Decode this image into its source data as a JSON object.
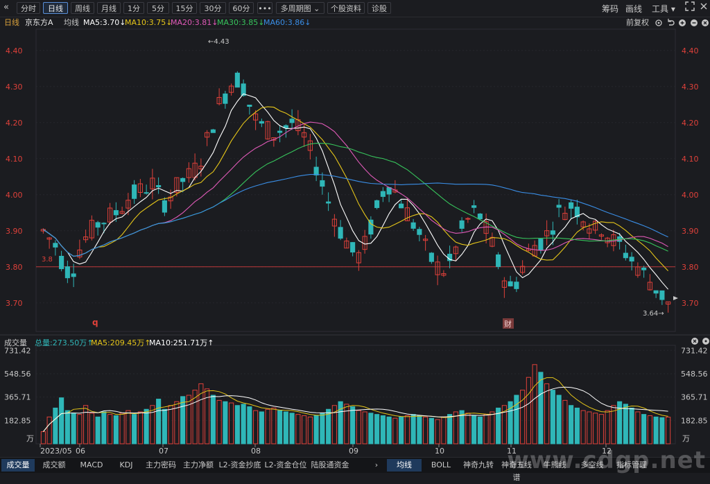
{
  "toolbar": {
    "collapse_icon": "«",
    "buttons": [
      "分时",
      "日线",
      "周线",
      "月线",
      "1分",
      "5分",
      "15分",
      "30分",
      "60分",
      "•••",
      "多周期图 ⌄",
      "个股资料",
      "诊股"
    ],
    "active": "日线",
    "right": [
      "筹码",
      "画线",
      "工具 ▾"
    ],
    "expand_icon": "expand-icon",
    "close_icon": "close-icon"
  },
  "info_bar": {
    "period": "日线",
    "stock_name": "京东方A",
    "line_type": "均线",
    "ma5": "MA5:3.70↓",
    "ma10": "MA10:3.75↓",
    "ma20": "MA20:3.81↓",
    "ma30": "MA30:3.85↓",
    "ma60": "MA60:3.86↓",
    "adjust": "前复权",
    "colors": {
      "ma5": "#ffffff",
      "ma10": "#e6c619",
      "ma20": "#e05ab8",
      "ma30": "#37c45c",
      "ma60": "#3a8ee6"
    }
  },
  "volume_bar": {
    "title": "成交量",
    "total": "总量:273.50万↑",
    "ma5": "MA5:209.45万↑",
    "ma10": "MA10:251.71万↑"
  },
  "bottom_tabs": {
    "left": [
      "成交量",
      "成交额",
      "MACD",
      "KDJ",
      "主力密码",
      "主力净额",
      "L2-资金抄底",
      "L2-资金仓位",
      "陆股通资金"
    ],
    "right": [
      "均线",
      "BOLL",
      "神奇九转",
      "神奇五线谱",
      "牛熊线",
      "多空线",
      "指标管理"
    ],
    "active_left": "成交量",
    "active_right": "均线",
    "arrow": "›"
  },
  "watermark": "www.cdgp.net",
  "chart_data": {
    "type": "candlestick",
    "price_axis": {
      "ticks": [
        "4.40",
        "4.30",
        "4.20",
        "4.10",
        "4.00",
        "3.90",
        "3.80",
        "3.70"
      ],
      "ylim": [
        3.64,
        4.44
      ]
    },
    "volume_axis": {
      "ticks": [
        "731.42",
        "548.56",
        "365.71",
        "182.85"
      ],
      "unit": "万",
      "ylim": [
        0,
        760
      ]
    },
    "x_ticks": [
      "2023/05",
      "06",
      "07",
      "08",
      "09",
      "10",
      "11",
      "12"
    ],
    "reference_line": {
      "value": 3.8,
      "label": "3.8"
    },
    "annotations": {
      "high": "4.43",
      "low": "3.64",
      "markers": [
        "q",
        "财"
      ]
    },
    "ma_values": [
      3.9,
      3.88,
      3.86,
      3.82,
      3.79,
      3.8,
      3.85,
      3.88,
      3.9,
      3.92,
      3.93,
      3.94,
      3.95,
      3.97,
      3.99,
      4.0,
      4.01,
      4.02,
      4.03,
      4.0,
      3.98,
      4.0,
      4.02,
      4.04,
      4.05,
      4.07,
      4.1,
      4.15,
      4.2,
      4.25,
      4.28,
      4.31,
      4.32,
      4.3,
      4.25,
      4.21,
      4.19,
      4.18,
      4.17,
      4.18,
      4.19,
      4.2,
      4.18,
      4.16,
      4.12,
      4.08,
      4.03,
      3.98,
      3.94,
      3.9,
      3.87,
      3.84,
      3.83,
      3.86,
      3.91,
      3.96,
      4.01,
      4.03,
      4.01,
      3.98,
      3.95,
      3.92,
      3.89,
      3.85,
      3.82,
      3.8,
      3.79,
      3.81,
      3.85,
      3.9,
      3.93,
      3.95,
      3.94,
      3.9,
      3.86,
      3.81,
      3.77,
      3.74,
      3.76,
      3.8,
      3.84,
      3.86,
      3.87,
      3.89,
      3.92,
      3.95,
      3.96,
      3.97,
      3.96,
      3.94,
      3.92,
      3.9,
      3.91,
      3.89,
      3.87,
      3.86,
      3.84,
      3.82,
      3.8,
      3.78,
      3.76,
      3.74,
      3.72,
      3.7
    ],
    "volume_values": [
      95,
      210,
      280,
      360,
      260,
      240,
      230,
      300,
      240,
      210,
      250,
      230,
      220,
      240,
      260,
      230,
      250,
      270,
      300,
      350,
      270,
      300,
      330,
      370,
      380,
      420,
      470,
      430,
      380,
      340,
      330,
      320,
      300,
      310,
      290,
      260,
      250,
      270,
      280,
      260,
      250,
      240,
      230,
      220,
      210,
      220,
      240,
      270,
      300,
      330,
      310,
      290,
      260,
      250,
      240,
      230,
      220,
      210,
      200,
      210,
      220,
      230,
      220,
      210,
      200,
      190,
      210,
      230,
      250,
      260,
      240,
      220,
      210,
      230,
      250,
      280,
      300,
      330,
      380,
      420,
      520,
      620,
      560,
      470,
      420,
      380,
      340,
      300,
      280,
      260,
      250,
      240,
      230,
      260,
      300,
      330,
      310,
      280,
      250,
      230,
      220,
      210,
      205,
      209
    ]
  }
}
